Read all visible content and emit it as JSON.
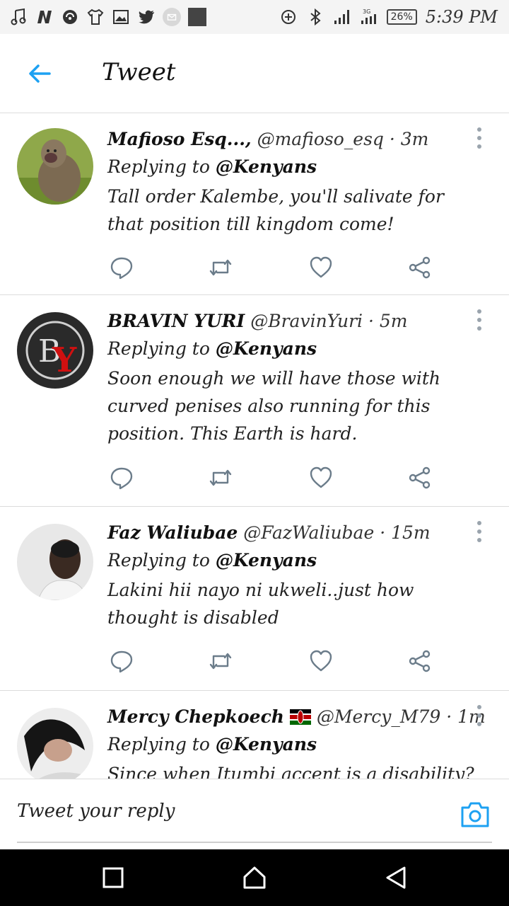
{
  "status_bar": {
    "time": "5:39 PM",
    "battery": "26%",
    "network": "3G",
    "left_icons": [
      "music-icon",
      "n-app-icon",
      "hotspot-app-icon",
      "tshirt-icon",
      "gallery-icon",
      "twitter-icon",
      "mail-icon",
      "square-app-icon"
    ],
    "right_icons": [
      "data-saver-icon",
      "bluetooth-icon",
      "signal-icon",
      "signal-3g-icon",
      "battery-icon"
    ]
  },
  "header": {
    "title": "Tweet",
    "back_icon": "arrow-left-icon",
    "accent": "#1da1f2"
  },
  "tweets": [
    {
      "name": "Mafioso Esq...,",
      "handle": "@mafioso_esq",
      "time": "3m",
      "replying_prefix": "Replying to",
      "replying_to": "@Kenyans",
      "text": "Tall order Kalembe, you'll salivate for that position till kingdom come!"
    },
    {
      "name": "BRAVIN YURI",
      "handle": "@BravinYuri",
      "time": "5m",
      "replying_prefix": "Replying to",
      "replying_to": "@Kenyans",
      "text": "Soon enough we will have those with curved penises also running for this position. This Earth is hard."
    },
    {
      "name": "Faz Waliubae",
      "handle": "@FazWaliubae",
      "time": "15m",
      "replying_prefix": "Replying to",
      "replying_to": "@Kenyans",
      "text": "Lakini hii nayo ni ukweli..just how thought is disabled"
    },
    {
      "name": "Mercy Chepkoech",
      "name_emoji": "kenya-flag-icon",
      "handle": "@Mercy_M79",
      "time": "1m",
      "replying_prefix": "Replying to",
      "replying_to": "@Kenyans",
      "text": "Since when Itumbi accent is a disability?"
    }
  ],
  "separator": "·",
  "action_icons": [
    "reply-icon",
    "retweet-icon",
    "like-icon",
    "share-icon"
  ],
  "reply_bar": {
    "placeholder": "Tweet your reply",
    "camera_icon": "camera-icon"
  },
  "nav_bar": {
    "icons": [
      "recents-icon",
      "home-icon",
      "back-icon"
    ]
  }
}
